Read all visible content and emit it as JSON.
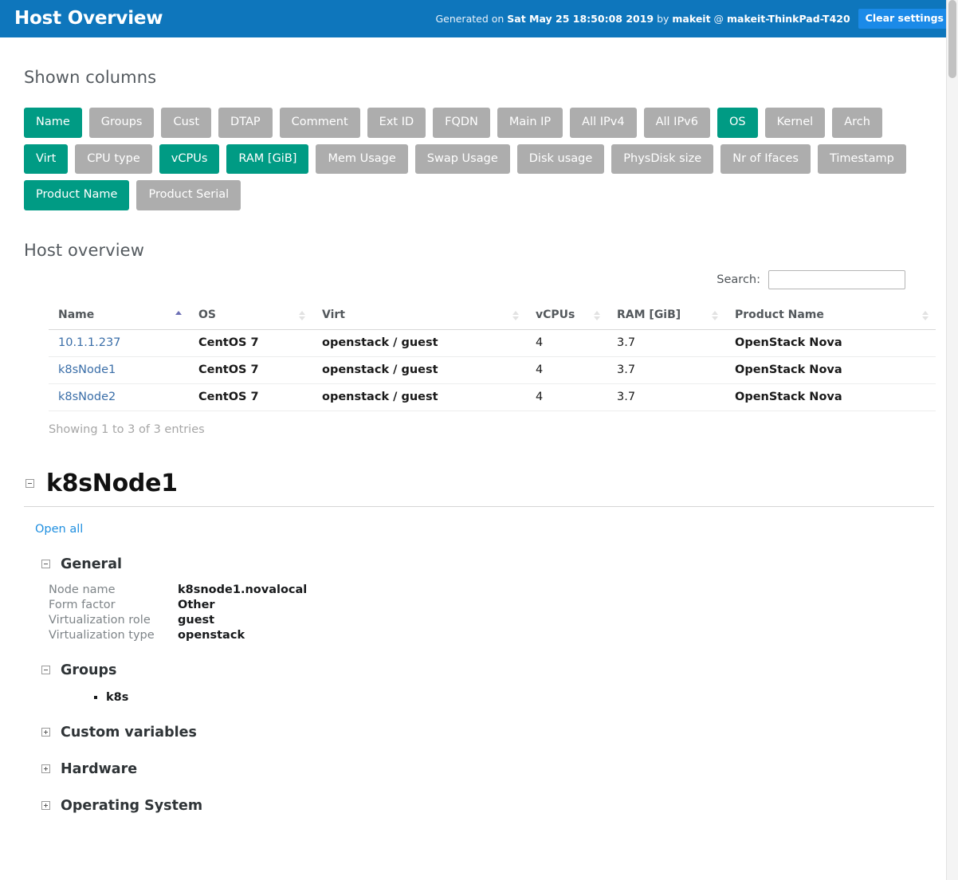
{
  "topbar": {
    "title": "Host Overview",
    "generated_prefix": "Generated on ",
    "generated_timestamp": "Sat May 25 18:50:08 2019",
    "generated_by_label": " by ",
    "generated_user": "makeit",
    "generated_at_symbol": " @ ",
    "generated_host": "makeit-ThinkPad-T420",
    "clear_settings_label": "Clear settings",
    "bg_color": "#0e76bc",
    "button_color": "#1b8ae8"
  },
  "shown_columns": {
    "title": "Shown columns",
    "active_color": "#009b84",
    "inactive_color": "#adadad",
    "buttons": [
      {
        "label": "Name",
        "active": true
      },
      {
        "label": "Groups",
        "active": false
      },
      {
        "label": "Cust",
        "active": false
      },
      {
        "label": "DTAP",
        "active": false
      },
      {
        "label": "Comment",
        "active": false
      },
      {
        "label": "Ext ID",
        "active": false
      },
      {
        "label": "FQDN",
        "active": false
      },
      {
        "label": "Main IP",
        "active": false
      },
      {
        "label": "All IPv4",
        "active": false
      },
      {
        "label": "All IPv6",
        "active": false
      },
      {
        "label": "OS",
        "active": true
      },
      {
        "label": "Kernel",
        "active": false
      },
      {
        "label": "Arch",
        "active": false
      },
      {
        "label": "Virt",
        "active": true
      },
      {
        "label": "CPU type",
        "active": false
      },
      {
        "label": "vCPUs",
        "active": true
      },
      {
        "label": "RAM [GiB]",
        "active": true
      },
      {
        "label": "Mem Usage",
        "active": false
      },
      {
        "label": "Swap Usage",
        "active": false
      },
      {
        "label": "Disk usage",
        "active": false
      },
      {
        "label": "PhysDisk size",
        "active": false
      },
      {
        "label": "Nr of Ifaces",
        "active": false
      },
      {
        "label": "Timestamp",
        "active": false
      },
      {
        "label": "Product Name",
        "active": true
      },
      {
        "label": "Product Serial",
        "active": false
      }
    ]
  },
  "host_overview": {
    "title": "Host overview",
    "search_label": "Search:",
    "search_value": "",
    "search_placeholder": "",
    "columns": [
      {
        "label": "Name",
        "sort": "asc"
      },
      {
        "label": "OS",
        "sort": "none"
      },
      {
        "label": "Virt",
        "sort": "none"
      },
      {
        "label": "vCPUs",
        "sort": "none"
      },
      {
        "label": "RAM [GiB]",
        "sort": "none"
      },
      {
        "label": "Product Name",
        "sort": "none"
      }
    ],
    "rows": [
      {
        "name": "10.1.1.237",
        "os": "CentOS 7",
        "virt": "openstack / guest",
        "vcpus": "4",
        "ram": "3.7",
        "product": "OpenStack Nova"
      },
      {
        "name": "k8sNode1",
        "os": "CentOS 7",
        "virt": "openstack / guest",
        "vcpus": "4",
        "ram": "3.7",
        "product": "OpenStack Nova"
      },
      {
        "name": "k8sNode2",
        "os": "CentOS 7",
        "virt": "openstack / guest",
        "vcpus": "4",
        "ram": "3.7",
        "product": "OpenStack Nova"
      }
    ],
    "showing_entries": "Showing 1 to 3 of 3 entries"
  },
  "host_detail": {
    "heading": "k8sNode1",
    "open_all_label": "Open all",
    "general": {
      "title": "General",
      "properties": [
        {
          "key": "Node name",
          "value": "k8snode1.novalocal"
        },
        {
          "key": "Form factor",
          "value": "Other"
        },
        {
          "key": "Virtualization role",
          "value": "guest"
        },
        {
          "key": "Virtualization type",
          "value": "openstack"
        }
      ]
    },
    "groups": {
      "title": "Groups",
      "items": [
        "k8s"
      ]
    },
    "collapsed_sections": [
      {
        "title": "Custom variables"
      },
      {
        "title": "Hardware"
      },
      {
        "title": "Operating System"
      }
    ]
  }
}
